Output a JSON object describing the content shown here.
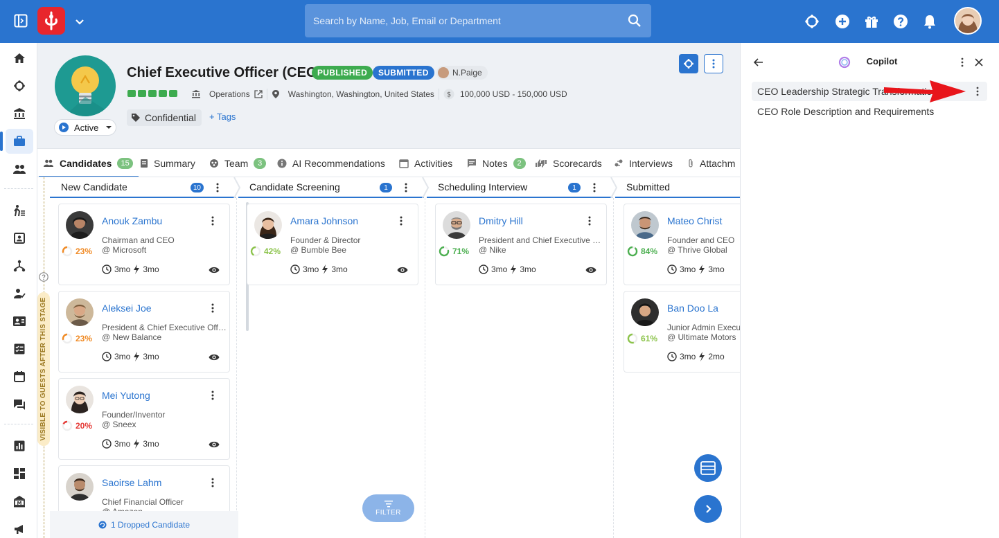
{
  "topbar": {
    "search_placeholder": "Search by Name, Job, Email or Department",
    "icons": [
      "panel-toggle-icon",
      "logo-icon",
      "chevron-down-icon",
      "search-icon",
      "copilot-icon",
      "add-circle-icon",
      "gift-icon",
      "help-icon",
      "bell-icon",
      "avatar"
    ]
  },
  "sidebar": {
    "items": [
      "home-icon",
      "copilot-icon",
      "bank-icon",
      "briefcase-icon",
      "people-icon",
      "hiring-icon",
      "contact-card-icon",
      "hierarchy-icon",
      "person-check-icon",
      "id-card-icon",
      "checklist-icon",
      "calendar-icon",
      "chat-icon",
      "bar-chart-icon",
      "dashboard-icon",
      "institution-icon",
      "megaphone-icon"
    ],
    "active": "briefcase-icon"
  },
  "job": {
    "title": "Chief Executive Officer (CEO)",
    "badge_published": "PUBLISHED",
    "badge_submitted": "SUBMITTED",
    "owner": "N.Paige",
    "department": "Operations",
    "location": "Washington, Washington, United States",
    "salary": "100,000 USD - 150,000 USD",
    "tag": "Confidential",
    "add_tags": "+ Tags",
    "status": "Active"
  },
  "tabs": [
    {
      "label": "Candidates",
      "count": "15",
      "icon": "people-icon"
    },
    {
      "label": "Summary",
      "count": "",
      "icon": "document-icon"
    },
    {
      "label": "Team",
      "count": "3",
      "icon": "team-icon"
    },
    {
      "label": "AI Recommendations",
      "count": "",
      "icon": "info-icon"
    },
    {
      "label": "Activities",
      "count": "",
      "icon": "calendar-icon"
    },
    {
      "label": "Notes",
      "count": "2",
      "icon": "note-icon"
    },
    {
      "label": "Scorecards",
      "count": "",
      "icon": "thumbs-icon"
    },
    {
      "label": "Interviews",
      "count": "",
      "icon": "interview-icon"
    },
    {
      "label": "Attachm",
      "count": "",
      "icon": "paperclip-icon"
    }
  ],
  "guest_label": "VISIBLE TO GUESTS AFTER THIS STAGE",
  "columns": [
    {
      "title": "New Candidate",
      "count": "10",
      "cards": [
        {
          "name": "Anouk Zambu",
          "role": "Chairman and CEO",
          "company": "@ Microsoft",
          "score": "23%",
          "seen": "3mo",
          "active": "3mo",
          "color": "#f08a24"
        },
        {
          "name": "Aleksei Joe",
          "role": "President & Chief Executive Offi...",
          "company": "@ New Balance",
          "score": "23%",
          "seen": "3mo",
          "active": "3mo",
          "color": "#f08a24"
        },
        {
          "name": "Mei Yutong",
          "role": "Founder/Inventor",
          "company": "@ Sneex",
          "score": "20%",
          "seen": "3mo",
          "active": "3mo",
          "color": "#e53935"
        },
        {
          "name": "Saoirse Lahm",
          "role": "Chief Financial Officer",
          "company": "@ Amazon",
          "score": "",
          "seen": "",
          "active": "",
          "color": "#e53935"
        }
      ],
      "dropped": "1 Dropped Candidate"
    },
    {
      "title": "Candidate Screening",
      "count": "1",
      "cards": [
        {
          "name": "Amara Johnson",
          "role": "Founder & Director",
          "company": "@ Bumble Bee",
          "score": "42%",
          "seen": "3mo",
          "active": "3mo",
          "color": "#8bc34a"
        }
      ]
    },
    {
      "title": "Scheduling Interview",
      "count": "1",
      "cards": [
        {
          "name": "Dmitry Hill",
          "role": "President and Chief Executive O...",
          "company": "@ Nike",
          "score": "71%",
          "seen": "3mo",
          "active": "3mo",
          "color": "#4caf50"
        }
      ]
    },
    {
      "title": "Submitted",
      "count": "",
      "cards": [
        {
          "name": "Mateo Christ",
          "role": "Founder and CEO",
          "company": "@ Thrive Global",
          "score": "84%",
          "seen": "3mo",
          "active": "3mo",
          "color": "#4caf50"
        },
        {
          "name": "Ban Doo La",
          "role": "Junior Admin Executive",
          "company": "@ Ultimate Motors",
          "score": "61%",
          "seen": "3mo",
          "active": "2mo",
          "color": "#8bc34a"
        }
      ]
    }
  ],
  "filter_label": "FILTER",
  "copilot": {
    "title": "Copilot",
    "items": [
      "CEO Leadership Strategic Transformation",
      "CEO Role Description and Requirements"
    ]
  },
  "colors": {
    "primary": "#2a74cf",
    "published": "#3dab4f",
    "submitted": "#2a74cf",
    "annotation_arrow": "#e8151b"
  }
}
